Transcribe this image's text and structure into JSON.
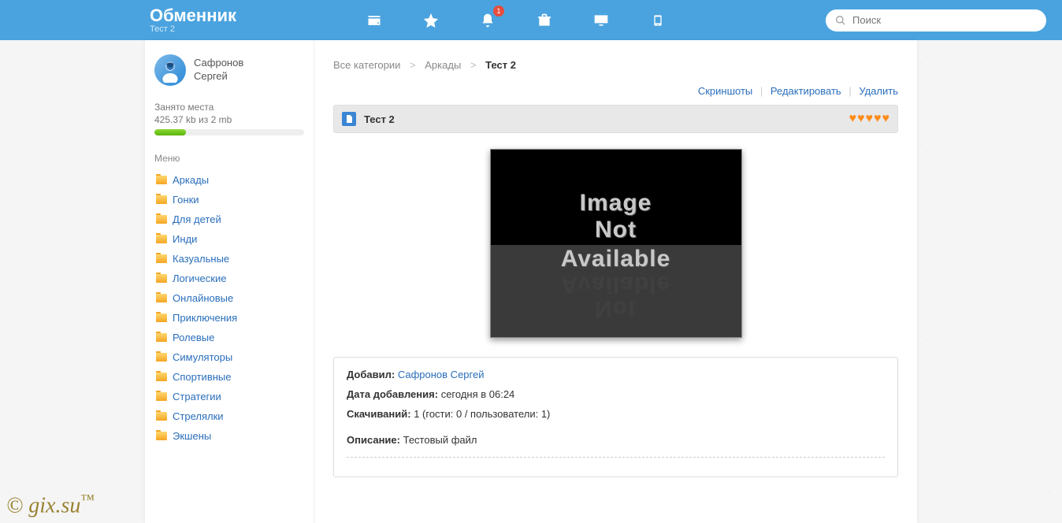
{
  "header": {
    "logo_title": "Обменник",
    "logo_subtitle": "Тест 2",
    "notification_count": "1",
    "search_placeholder": "Поиск"
  },
  "user": {
    "first_line": "Сафронов",
    "second_line": "Сергей"
  },
  "storage": {
    "label": "Занято места",
    "value": "425.37 kb из 2 mb"
  },
  "menu": {
    "title": "Меню",
    "items": [
      "Аркады",
      "Гонки",
      "Для детей",
      "Инди",
      "Казуальные",
      "Логические",
      "Онлайновые",
      "Приключения",
      "Ролевые",
      "Симуляторы",
      "Спортивные",
      "Стратегии",
      "Стрелялки",
      "Экшены"
    ]
  },
  "breadcrumb": {
    "all": "Все категории",
    "cat": "Аркады",
    "current": "Тест 2"
  },
  "actions": {
    "screenshots": "Скриншоты",
    "edit": "Редактировать",
    "delete": "Удалить"
  },
  "titlebar": {
    "text": "Тест 2",
    "heart_count": 5
  },
  "image_placeholder": {
    "line1": "Image",
    "line2": "Not",
    "line3": "Available"
  },
  "details": {
    "added_by_label": "Добавил:",
    "added_by_value": "Сафронов Сергей",
    "date_label": "Дата добавления:",
    "date_value": "сегодня в 06:24",
    "downloads_label": "Скачиваний:",
    "downloads_value": "1 (гости: 0 / пользователи: 1)",
    "desc_label": "Описание:",
    "desc_value": "Тестовый файл"
  },
  "watermark": "© gix.su™"
}
